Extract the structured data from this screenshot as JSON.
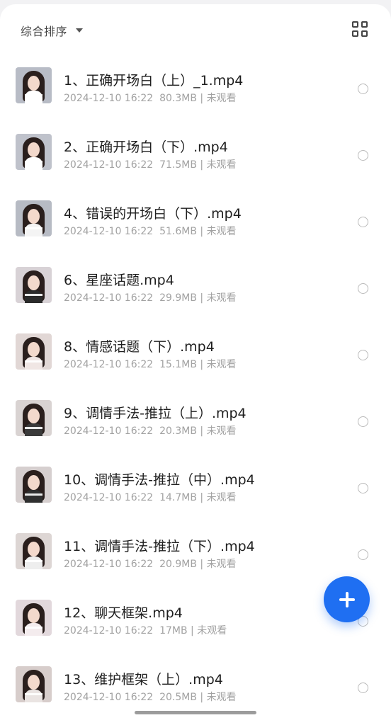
{
  "toolbar": {
    "sort_label": "综合排序",
    "sort_icon": "caret-down-icon",
    "view_icon": "grid-view-icon"
  },
  "files": [
    {
      "title": "1、正确开场白（上）_1.mp4",
      "date": "2024-12-10 16:22",
      "size": "80.3MB",
      "status": "未观看",
      "thumb_bg": "#b8bcc6",
      "top_color": "#ffffff"
    },
    {
      "title": "2、正确开场白（下）.mp4",
      "date": "2024-12-10 16:22",
      "size": "71.5MB",
      "status": "未观看",
      "thumb_bg": "#bfc2cb",
      "top_color": "#ffffff"
    },
    {
      "title": "4、错误的开场白（下）.mp4",
      "date": "2024-12-10 16:22",
      "size": "51.6MB",
      "status": "未观看",
      "thumb_bg": "#b7bbc4",
      "top_color": "#f4f4f4"
    },
    {
      "title": "6、星座话题.mp4",
      "date": "2024-12-10 16:22",
      "size": "29.9MB",
      "status": "未观看",
      "thumb_bg": "#d8d2d6",
      "top_color": "#2b2b2b"
    },
    {
      "title": "8、情感话题（下）.mp4",
      "date": "2024-12-10 16:22",
      "size": "15.1MB",
      "status": "未观看",
      "thumb_bg": "#e1d7d5",
      "top_color": "#f0e6e4"
    },
    {
      "title": "9、调情手法-推拉（上）.mp4",
      "date": "2024-12-10 16:22",
      "size": "20.3MB",
      "status": "未观看",
      "thumb_bg": "#d9d3d2",
      "top_color": "#3a3a3a"
    },
    {
      "title": "10、调情手法-推拉（中）.mp4",
      "date": "2024-12-10 16:22",
      "size": "14.7MB",
      "status": "未观看",
      "thumb_bg": "#d6cfcf",
      "top_color": "#2f2f2f"
    },
    {
      "title": "11、调情手法-推拉（下）.mp4",
      "date": "2024-12-10 16:22",
      "size": "20.9MB",
      "status": "未观看",
      "thumb_bg": "#ddd6d4",
      "top_color": "#eeeeee"
    },
    {
      "title": "12、聊天框架.mp4",
      "date": "2024-12-10 16:22",
      "size": "17MB",
      "status": "未观看",
      "thumb_bg": "#e2d8dc",
      "top_color": "#f4ecee"
    },
    {
      "title": "13、维护框架（上）.mp4",
      "date": "2024-12-10 16:22",
      "size": "20.5MB",
      "status": "未观看",
      "thumb_bg": "#d7cdcb",
      "top_color": "#eae4e2"
    }
  ],
  "fab": {
    "icon": "plus-icon",
    "color": "#1f6ff2"
  }
}
